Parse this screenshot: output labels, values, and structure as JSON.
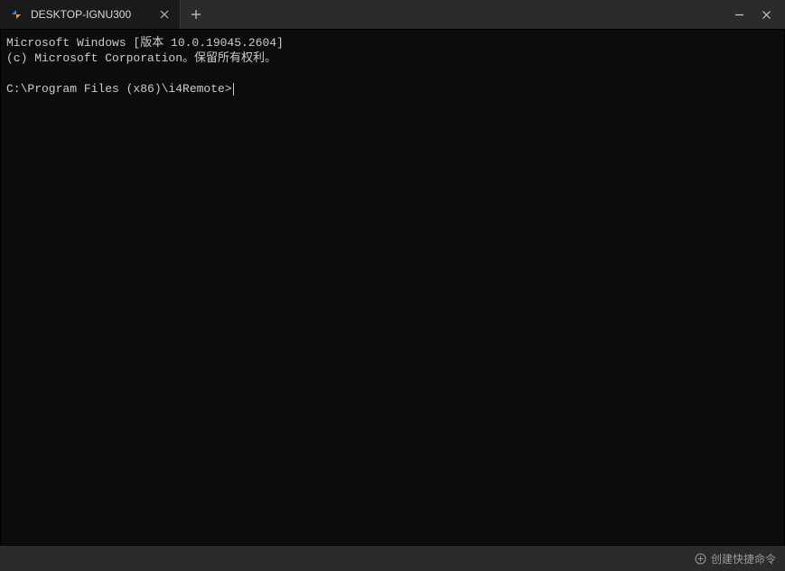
{
  "tab": {
    "title": "DESKTOP-IGNU300"
  },
  "terminal": {
    "line1": "Microsoft Windows [版本 10.0.19045.2604]",
    "line2": "(c) Microsoft Corporation。保留所有权利。",
    "prompt": "C:\\Program Files (x86)\\i4Remote>"
  },
  "statusbar": {
    "shortcut_label": "创建快捷命令"
  }
}
